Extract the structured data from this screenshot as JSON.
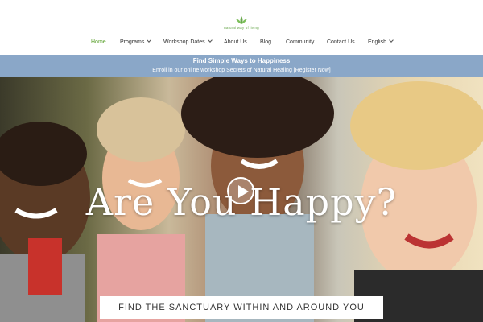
{
  "logo": {
    "text": "natural way of living",
    "icon": "lotus-icon",
    "color": "#6aa84f"
  },
  "nav": {
    "items": [
      {
        "label": "Home",
        "active": true
      },
      {
        "label": "Programs",
        "dropdown": true
      },
      {
        "label": "Workshop Dates",
        "dropdown": true
      },
      {
        "label": "About Us"
      },
      {
        "label": "Blog"
      },
      {
        "label": "Community"
      },
      {
        "label": "Contact Us"
      },
      {
        "label": "English",
        "dropdown": true
      }
    ],
    "active_color": "#5aa02c"
  },
  "banner": {
    "title": "Find Simple Ways to Happiness",
    "subtitle": "Enroll in our online workshop Secrets of Natural Healing [Register Now]",
    "background": "#8aa7c8"
  },
  "hero": {
    "heading": "Are You Happy?",
    "play_icon": "play-icon",
    "cta": "FIND THE SANCTUARY WITHIN AND AROUND YOU"
  }
}
